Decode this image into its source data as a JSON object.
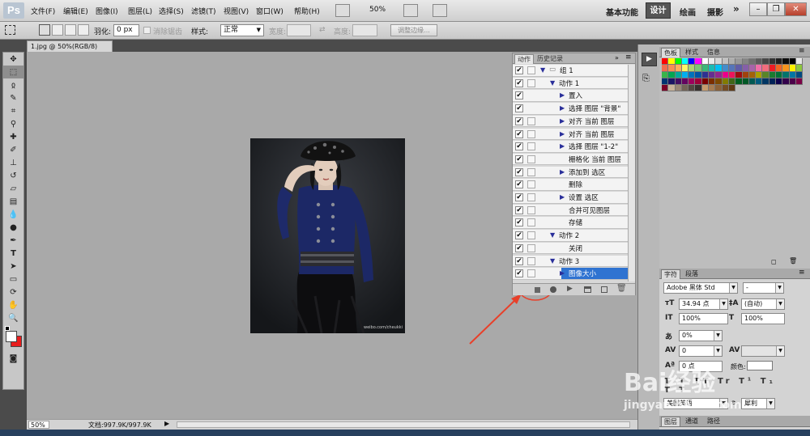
{
  "menubar": {
    "logo": "Ps",
    "items": [
      "文件(F)",
      "编辑(E)",
      "图像(I)",
      "图层(L)",
      "选择(S)",
      "滤镜(T)",
      "视图(V)",
      "窗口(W)",
      "帮助(H)"
    ],
    "zoom": "50%",
    "workspaces": [
      "基本功能",
      "设计",
      "绘画",
      "摄影"
    ],
    "active_workspace": "设计",
    "more": "»"
  },
  "options": {
    "feather_label": "羽化:",
    "feather_value": "0 px",
    "antialias_label": "消除锯齿",
    "style_label": "样式:",
    "style_value": "正常",
    "width_label": "宽度:",
    "height_label": "高度:",
    "refine_edge": "调整边缘..."
  },
  "document": {
    "tab_title": "1.jpg @ 50%(RGB/8) *",
    "photo_credit": "weibo.com/cheukki",
    "status_zoom": "50%",
    "status_doc": "文档:997.9K/997.9K"
  },
  "actions_panel": {
    "tabs": [
      "动作",
      "历史记录"
    ],
    "rows": [
      {
        "text": "组 1",
        "indent": 0,
        "triangle": "▼",
        "folder": true,
        "dialog": true,
        "selected": false
      },
      {
        "text": "动作 1",
        "indent": 1,
        "triangle": "▼",
        "folder": false,
        "dialog": true,
        "selected": false
      },
      {
        "text": "置入",
        "indent": 2,
        "triangle": "▶",
        "folder": false,
        "dialog": false,
        "selected": false
      },
      {
        "text": "选择 图层 \"背景\"",
        "indent": 2,
        "triangle": "▶",
        "folder": false,
        "dialog": false,
        "selected": false
      },
      {
        "text": "对齐 当前 图层",
        "indent": 2,
        "triangle": "▶",
        "folder": false,
        "dialog": true,
        "selected": false
      },
      {
        "text": "对齐 当前 图层",
        "indent": 2,
        "triangle": "▶",
        "folder": false,
        "dialog": true,
        "selected": false
      },
      {
        "text": "选择 图层 \"1-2\"",
        "indent": 2,
        "triangle": "▶",
        "folder": false,
        "dialog": true,
        "selected": false
      },
      {
        "text": "栅格化 当前 图层",
        "indent": 2,
        "triangle": "",
        "folder": false,
        "dialog": true,
        "selected": false
      },
      {
        "text": "添加到 选区",
        "indent": 2,
        "triangle": "▶",
        "folder": false,
        "dialog": true,
        "selected": false
      },
      {
        "text": "删除",
        "indent": 2,
        "triangle": "",
        "folder": false,
        "dialog": true,
        "selected": false
      },
      {
        "text": "设置 选区",
        "indent": 2,
        "triangle": "▶",
        "folder": false,
        "dialog": true,
        "selected": false
      },
      {
        "text": "合并可见图层",
        "indent": 2,
        "triangle": "",
        "folder": false,
        "dialog": true,
        "selected": false
      },
      {
        "text": "存储",
        "indent": 2,
        "triangle": "",
        "folder": false,
        "dialog": true,
        "selected": false
      },
      {
        "text": "动作 2",
        "indent": 1,
        "triangle": "▼",
        "folder": false,
        "dialog": true,
        "selected": false
      },
      {
        "text": "关闭",
        "indent": 2,
        "triangle": "",
        "folder": false,
        "dialog": true,
        "selected": false
      },
      {
        "text": "动作 3",
        "indent": 1,
        "triangle": "▼",
        "folder": false,
        "dialog": true,
        "selected": false
      },
      {
        "text": "图像大小",
        "indent": 2,
        "triangle": "▶",
        "folder": false,
        "dialog": true,
        "selected": true
      }
    ]
  },
  "swatch_panel": {
    "tabs": [
      "色板",
      "样式",
      "信息"
    ]
  },
  "char_panel": {
    "tabs": [
      "字符",
      "段落"
    ],
    "font_family": "Adobe 黑体 Std",
    "font_style": "-",
    "size": "34.94 点",
    "leading": "(自动)",
    "vscale": "100%",
    "hscale": "100%",
    "tracking_pct": "0%",
    "kerning": "0",
    "baseline": "0 点",
    "color_label": "颜色:",
    "language": "美国英语",
    "aa_label": "a",
    "aa_value": "犀利"
  },
  "bottom_tabs": [
    "图层",
    "通道",
    "路径"
  ],
  "colors": {
    "accent_selection": "#2f73d1",
    "fg": "#ffffff",
    "bg": "#e81c1c",
    "annotation": "#e8402a"
  }
}
